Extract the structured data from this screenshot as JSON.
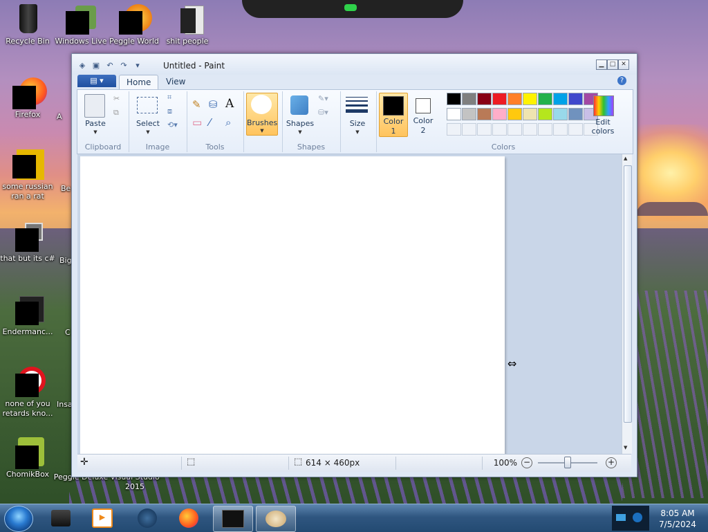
{
  "desktop": {
    "icons": [
      {
        "label": "Recycle Bin"
      },
      {
        "label": "Windows Live"
      },
      {
        "label": "Peggle World"
      },
      {
        "label": "shit people"
      },
      {
        "label": "Firefox"
      },
      {
        "label": "some russian ran a rat"
      },
      {
        "label": "that but its c#"
      },
      {
        "label": "Endermanc..."
      },
      {
        "label": "none of you retards kno..."
      },
      {
        "label": "ChomikBox"
      },
      {
        "label": "Peggle Deluxe"
      },
      {
        "label": "Visual Studio 2015"
      }
    ],
    "partial_labels": [
      "A",
      "Be",
      "Big",
      "C",
      "Insa"
    ]
  },
  "paint": {
    "title": "Untitled - Paint",
    "tabs": [
      {
        "label": "Home"
      },
      {
        "label": "View"
      }
    ],
    "ribbon": {
      "clipboard": {
        "paste": "Paste",
        "group": "Clipboard"
      },
      "image": {
        "select": "Select",
        "group": "Image"
      },
      "tools": {
        "group": "Tools"
      },
      "brushes": "Brushes",
      "shapes": {
        "label": "Shapes",
        "group": "Shapes"
      },
      "size": "Size",
      "color1": {
        "label": "Color",
        "num": "1"
      },
      "color2": {
        "label": "Color",
        "num": "2"
      },
      "edit_colors": {
        "line1": "Edit",
        "line2": "colors"
      },
      "colors_group": "Colors",
      "palette_row1": [
        "#000000",
        "#7f7f7f",
        "#880015",
        "#ed1c24",
        "#ff7f27",
        "#fff200",
        "#22b14c",
        "#00a2e8",
        "#3f48cc",
        "#a349a4"
      ],
      "palette_row2": [
        "#ffffff",
        "#c3c3c3",
        "#b97a57",
        "#ffaec9",
        "#ffc90e",
        "#efe4b0",
        "#b5e61d",
        "#99d9ea",
        "#7092be",
        "#c8bfe7"
      ],
      "color1_value": "#000000",
      "color2_value": "#ffffff"
    },
    "status": {
      "dimensions": "614 × 460px",
      "zoom": "100%"
    }
  },
  "taskbar": {
    "time": "8:05 AM",
    "date": "7/5/2024"
  }
}
